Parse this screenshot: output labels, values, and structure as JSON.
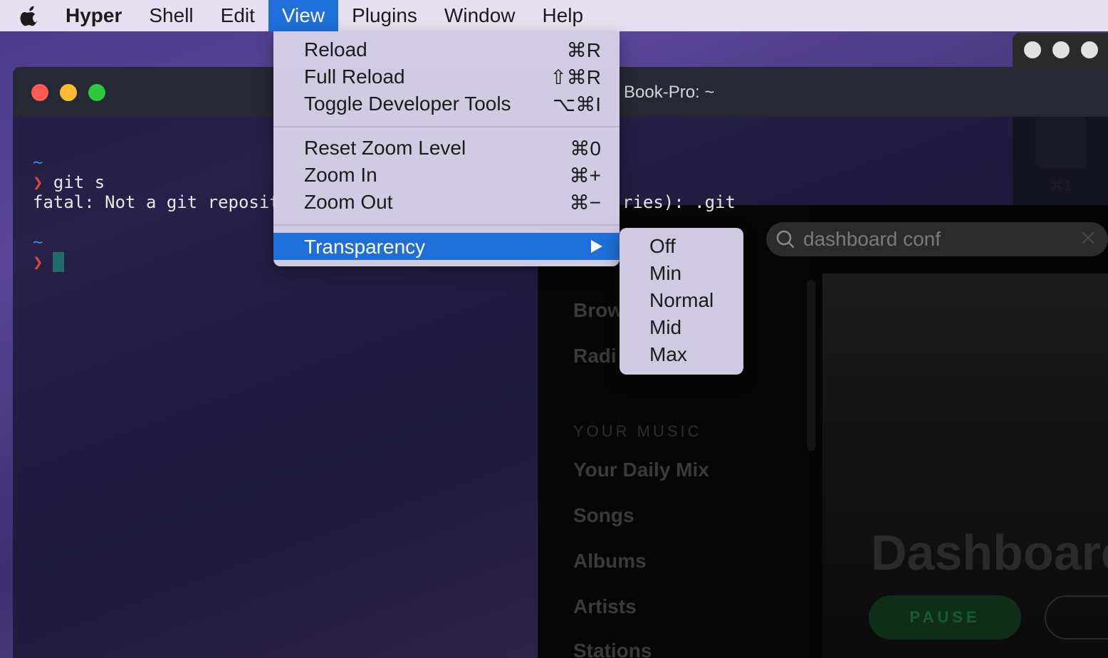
{
  "menubar": {
    "app_name": "Hyper",
    "items": [
      "Shell",
      "Edit",
      "View",
      "Plugins",
      "Window",
      "Help"
    ],
    "active_item": "View"
  },
  "view_menu": {
    "items": [
      {
        "label": "Reload",
        "shortcut": "⌘R"
      },
      {
        "label": "Full Reload",
        "shortcut": "⇧⌘R"
      },
      {
        "label": "Toggle Developer Tools",
        "shortcut": "⌥⌘I"
      },
      {
        "label": "Reset Zoom Level",
        "shortcut": "⌘0"
      },
      {
        "label": "Zoom In",
        "shortcut": "⌘+"
      },
      {
        "label": "Zoom Out",
        "shortcut": "⌘−"
      },
      {
        "label": "Transparency",
        "shortcut": ""
      }
    ],
    "highlighted": "Transparency"
  },
  "transparency_submenu": {
    "items": [
      "Off",
      "Min",
      "Normal",
      "Mid",
      "Max"
    ]
  },
  "terminal": {
    "title_fragment": "Book-Pro: ~",
    "lines": {
      "tilde1": "~",
      "prompt1_arrow": "❯",
      "prompt1_cmd": " git s",
      "error_left": "fatal: Not a git reposit",
      "error_right": "ries): .git",
      "tilde2": "~",
      "prompt2_arrow": "❯"
    }
  },
  "music_app": {
    "search_value": "dashboard conf",
    "nav_items": [
      "Brow",
      "Radi"
    ],
    "section_title": "YOUR MUSIC",
    "library_items": [
      "Your Daily Mix",
      "Songs",
      "Albums",
      "Artists",
      "Stations"
    ],
    "hero_title": "Dashboarc",
    "pause_label": "PAUSE"
  },
  "right_window": {
    "shortcut": "⌘1"
  },
  "colors": {
    "menu_highlight": "#1e6fd9",
    "menubar_bg": "#e7e0f2",
    "traffic_red": "#fd5b54",
    "traffic_yellow": "#fdbb2e",
    "traffic_green": "#2bc840"
  }
}
